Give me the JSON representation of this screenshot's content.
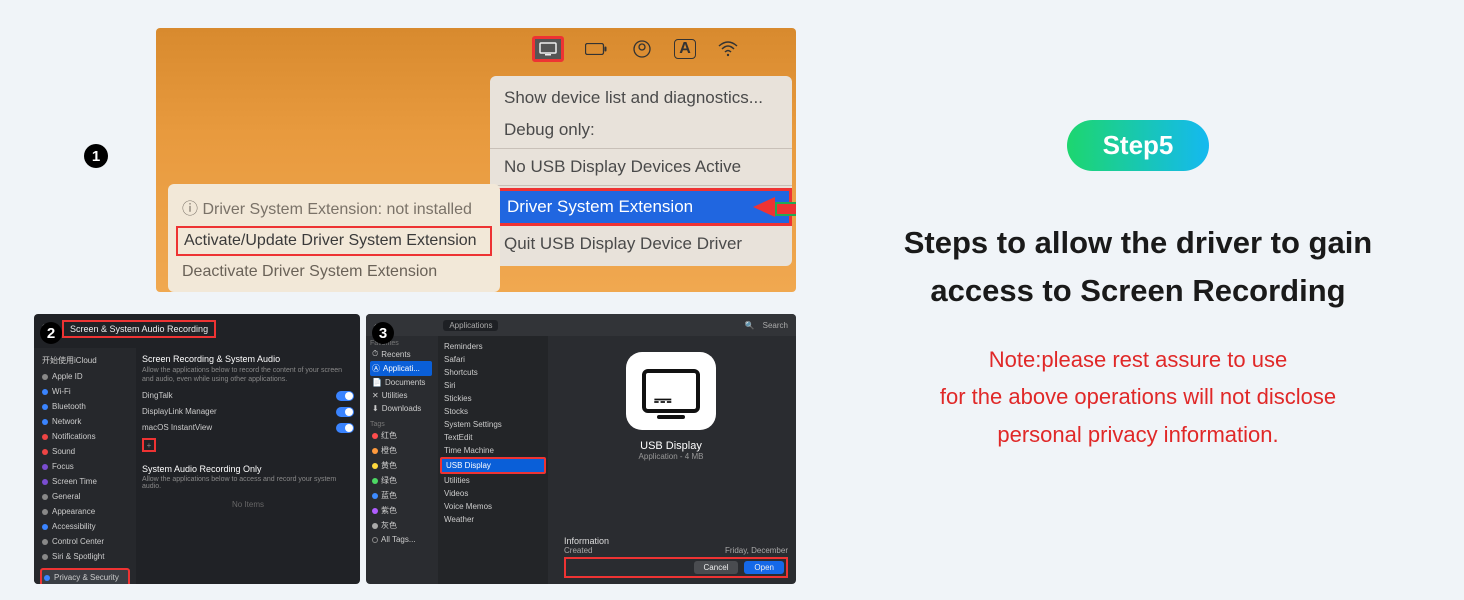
{
  "step_label": "Step5",
  "heading_line1": "Steps to allow the driver to gain",
  "heading_line2": "access to Screen Recording",
  "note_line1": "Note:please rest assure to use",
  "note_line2": "for the above operations will not disclose",
  "note_line3": "personal privacy information.",
  "badges": {
    "one": "1",
    "two": "2",
    "three": "3"
  },
  "panel1": {
    "dropdown": {
      "show": "Show device list and diagnostics...",
      "debug": "Debug only:",
      "nousb": "No USB Display Devices Active",
      "hilite": "Driver System Extension",
      "quit": "Quit USB Display Device Driver"
    },
    "submenu": {
      "info": "ⓘ Driver System Extension: not installed",
      "activate": "Activate/Update Driver System Extension",
      "deactivate": "Deactivate Driver System Extension"
    }
  },
  "panel2": {
    "title": "Screen & System Audio Recording",
    "section_h": "Screen Recording & System Audio",
    "section_sub": "Allow the applications below to record the content of your screen and audio, even while using other applications.",
    "sidebar_header": "开始使用iCloud",
    "sidebar": [
      "Apple ID",
      "Wi-Fi",
      "Bluetooth",
      "Network",
      "Notifications",
      "Sound",
      "Focus",
      "Screen Time",
      "General",
      "Appearance",
      "Accessibility",
      "Control Center",
      "Siri & Spotlight",
      "Privacy & Security"
    ],
    "apps": [
      "DingTalk",
      "DisplayLink Manager",
      "macOS InstantView"
    ],
    "only_h": "System Audio Recording Only",
    "only_sub": "Allow the applications below to access and record your system audio.",
    "no_items": "No Items"
  },
  "panel3": {
    "crumb": "Applications",
    "search": "Search",
    "side1_favorites": "Favorites",
    "side1": [
      "Recents",
      "Applicati...",
      "Documents",
      "Utilities",
      "Downloads"
    ],
    "side1_tags": "Tags",
    "tags": [
      {
        "label": "红色",
        "color": "#ff4d4d"
      },
      {
        "label": "橙色",
        "color": "#ff9a3d"
      },
      {
        "label": "黄色",
        "color": "#ffd93d"
      },
      {
        "label": "绿色",
        "color": "#4dd964"
      },
      {
        "label": "蓝色",
        "color": "#3d8bff"
      },
      {
        "label": "紫色",
        "color": "#b05dff"
      },
      {
        "label": "灰色",
        "color": "#aaa"
      },
      {
        "label": "All Tags...",
        "color": "transparent"
      }
    ],
    "files": [
      "Reminders",
      "Safari",
      "Shortcuts",
      "Siri",
      "Stickies",
      "Stocks",
      "System Settings",
      "TextEdit",
      "Time Machine",
      "USB Display",
      "Utilities",
      "Videos",
      "Voice Memos",
      "Weather"
    ],
    "selected_file": "USB Display",
    "preview_title": "USB Display",
    "preview_sub": "Application - 4 MB",
    "info_h": "Information",
    "info_created": "Created",
    "info_date": "Friday, December",
    "btn_cancel": "Cancel",
    "btn_open": "Open"
  }
}
